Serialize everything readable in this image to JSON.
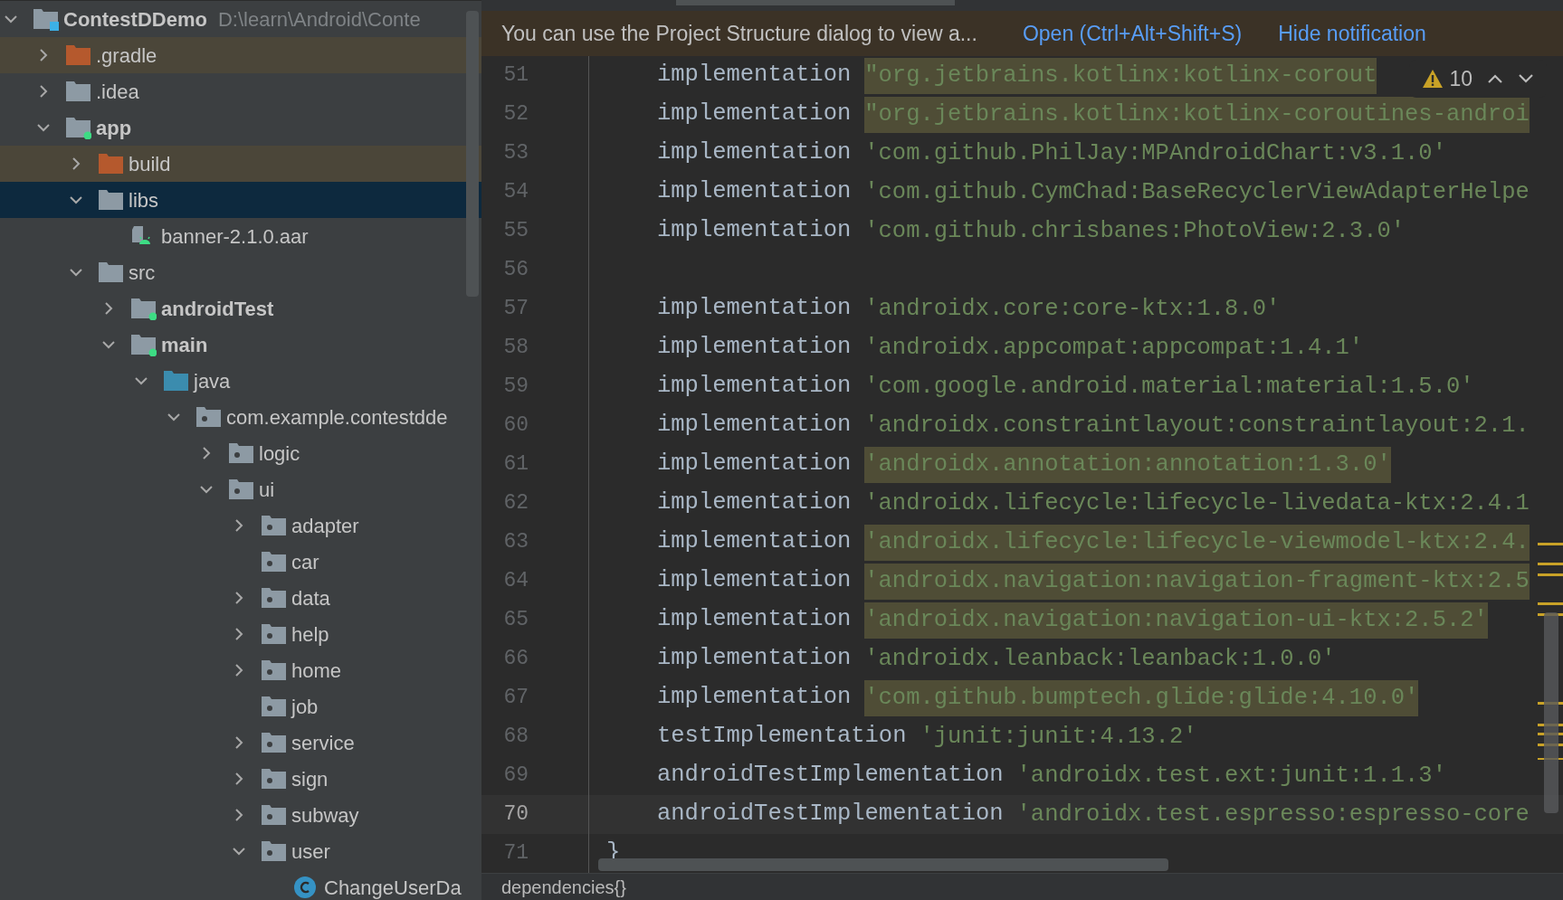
{
  "project_tree": {
    "items": [
      {
        "name": "ContestDDemo",
        "path": "D:\\learn\\Android\\Conte",
        "kind": "project",
        "expanded": true,
        "selected": false,
        "children": [
          {
            "name": ".gradle",
            "kind": "excluded-folder",
            "expanded": false,
            "selected": false
          },
          {
            "name": ".idea",
            "kind": "folder",
            "expanded": false,
            "selected": false
          },
          {
            "name": "app",
            "kind": "module",
            "expanded": true,
            "selected": false,
            "children": [
              {
                "name": "build",
                "kind": "excluded-folder",
                "expanded": false,
                "selected": false
              },
              {
                "name": "libs",
                "kind": "folder",
                "expanded": true,
                "selected": true,
                "children": [
                  {
                    "name": "banner-2.1.0.aar",
                    "kind": "library",
                    "selected": false
                  }
                ]
              },
              {
                "name": "src",
                "kind": "folder",
                "expanded": true,
                "selected": false,
                "children": [
                  {
                    "name": "androidTest",
                    "kind": "module",
                    "expanded": false,
                    "selected": false
                  },
                  {
                    "name": "main",
                    "kind": "module",
                    "expanded": true,
                    "selected": false,
                    "children": [
                      {
                        "name": "java",
                        "kind": "source-folder",
                        "expanded": true,
                        "selected": false,
                        "children": [
                          {
                            "name": "com.example.contestdde",
                            "kind": "package",
                            "expanded": true,
                            "selected": false,
                            "children": [
                              {
                                "name": "logic",
                                "kind": "package",
                                "expanded": false,
                                "selected": false
                              },
                              {
                                "name": "ui",
                                "kind": "package",
                                "expanded": true,
                                "selected": false,
                                "children": [
                                  {
                                    "name": "adapter",
                                    "kind": "package",
                                    "expanded": false,
                                    "selected": false
                                  },
                                  {
                                    "name": "car",
                                    "kind": "package",
                                    "selected": false
                                  },
                                  {
                                    "name": "data",
                                    "kind": "package",
                                    "expanded": false,
                                    "selected": false
                                  },
                                  {
                                    "name": "help",
                                    "kind": "package",
                                    "expanded": false,
                                    "selected": false
                                  },
                                  {
                                    "name": "home",
                                    "kind": "package",
                                    "expanded": false,
                                    "selected": false
                                  },
                                  {
                                    "name": "job",
                                    "kind": "package",
                                    "selected": false
                                  },
                                  {
                                    "name": "service",
                                    "kind": "package",
                                    "expanded": false,
                                    "selected": false
                                  },
                                  {
                                    "name": "sign",
                                    "kind": "package",
                                    "expanded": false,
                                    "selected": false
                                  },
                                  {
                                    "name": "subway",
                                    "kind": "package",
                                    "expanded": false,
                                    "selected": false
                                  },
                                  {
                                    "name": "user",
                                    "kind": "package",
                                    "expanded": true,
                                    "selected": false,
                                    "children": [
                                      {
                                        "name": "ChangeUserDa",
                                        "kind": "class",
                                        "selected": false
                                      }
                                    ]
                                  }
                                ]
                              }
                            ]
                          }
                        ]
                      }
                    ]
                  }
                ]
              }
            ]
          }
        ]
      }
    ]
  },
  "notification": {
    "text": "You can use the Project Structure dialog to view a...",
    "links": [
      "Open (Ctrl+Alt+Shift+S)",
      "Hide notification"
    ]
  },
  "inspection_widget": {
    "count": "10"
  },
  "editor": {
    "lines": [
      {
        "number": "51",
        "keyword": "implementation",
        "string": "\"org.jetbrains.kotlinx:kotlinx-corout",
        "highlighted": true,
        "current": false
      },
      {
        "number": "52",
        "keyword": "implementation",
        "string": "\"org.jetbrains.kotlinx:kotlinx-coroutines-androi",
        "highlighted": true,
        "current": false
      },
      {
        "number": "53",
        "keyword": "implementation",
        "string": "'com.github.PhilJay:MPAndroidChart:v3.1.0'",
        "highlighted": false,
        "current": false
      },
      {
        "number": "54",
        "keyword": "implementation",
        "string": "'com.github.CymChad:BaseRecyclerViewAdapterHelpe",
        "highlighted": false,
        "current": false
      },
      {
        "number": "55",
        "keyword": "implementation",
        "string": "'com.github.chrisbanes:PhotoView:2.3.0'",
        "highlighted": false,
        "current": false
      },
      {
        "number": "56",
        "current": false
      },
      {
        "number": "57",
        "keyword": "implementation",
        "string": "'androidx.core:core-ktx:1.8.0'",
        "highlighted": false,
        "current": false
      },
      {
        "number": "58",
        "keyword": "implementation",
        "string": "'androidx.appcompat:appcompat:1.4.1'",
        "highlighted": false,
        "current": false
      },
      {
        "number": "59",
        "keyword": "implementation",
        "string": "'com.google.android.material:material:1.5.0'",
        "highlighted": false,
        "current": false
      },
      {
        "number": "60",
        "keyword": "implementation",
        "string": "'androidx.constraintlayout:constraintlayout:2.1.",
        "highlighted": false,
        "current": false
      },
      {
        "number": "61",
        "keyword": "implementation",
        "string": "'androidx.annotation:annotation:1.3.0'",
        "highlighted": true,
        "current": false
      },
      {
        "number": "62",
        "keyword": "implementation",
        "string": "'androidx.lifecycle:lifecycle-livedata-ktx:2.4.1",
        "highlighted": false,
        "current": false
      },
      {
        "number": "63",
        "keyword": "implementation",
        "string": "'androidx.lifecycle:lifecycle-viewmodel-ktx:2.4.",
        "highlighted": true,
        "current": false
      },
      {
        "number": "64",
        "keyword": "implementation",
        "string": "'androidx.navigation:navigation-fragment-ktx:2.5",
        "highlighted": true,
        "current": false
      },
      {
        "number": "65",
        "keyword": "implementation",
        "string": "'androidx.navigation:navigation-ui-ktx:2.5.2'",
        "highlighted": true,
        "current": false
      },
      {
        "number": "66",
        "keyword": "implementation",
        "string": "'androidx.leanback:leanback:1.0.0'",
        "highlighted": false,
        "current": false
      },
      {
        "number": "67",
        "keyword": "implementation",
        "string": "'com.github.bumptech.glide:glide:4.10.0'",
        "highlighted": true,
        "current": false
      },
      {
        "number": "68",
        "keyword": "testImplementation",
        "string": "'junit:junit:4.13.2'",
        "highlighted": false,
        "current": false
      },
      {
        "number": "69",
        "keyword": "androidTestImplementation",
        "string": "'androidx.test.ext:junit:1.1.3'",
        "highlighted": false,
        "current": false
      },
      {
        "number": "70",
        "keyword": "androidTestImplementation",
        "string": "'androidx.test.espresso:espresso-core",
        "highlighted": false,
        "current": true
      },
      {
        "number": "71",
        "brace": "}",
        "current": false
      }
    ]
  },
  "breadcrumb": {
    "text": "dependencies{}"
  }
}
